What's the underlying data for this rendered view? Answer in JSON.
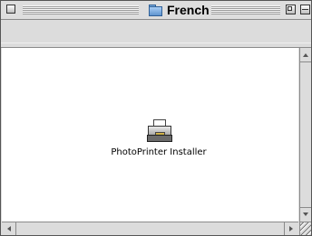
{
  "window": {
    "title": "French",
    "title_icon": "folder-icon"
  },
  "content": {
    "items": [
      {
        "label": "PhotoPrinter Installer",
        "icon": "printer-installer-icon"
      }
    ]
  }
}
